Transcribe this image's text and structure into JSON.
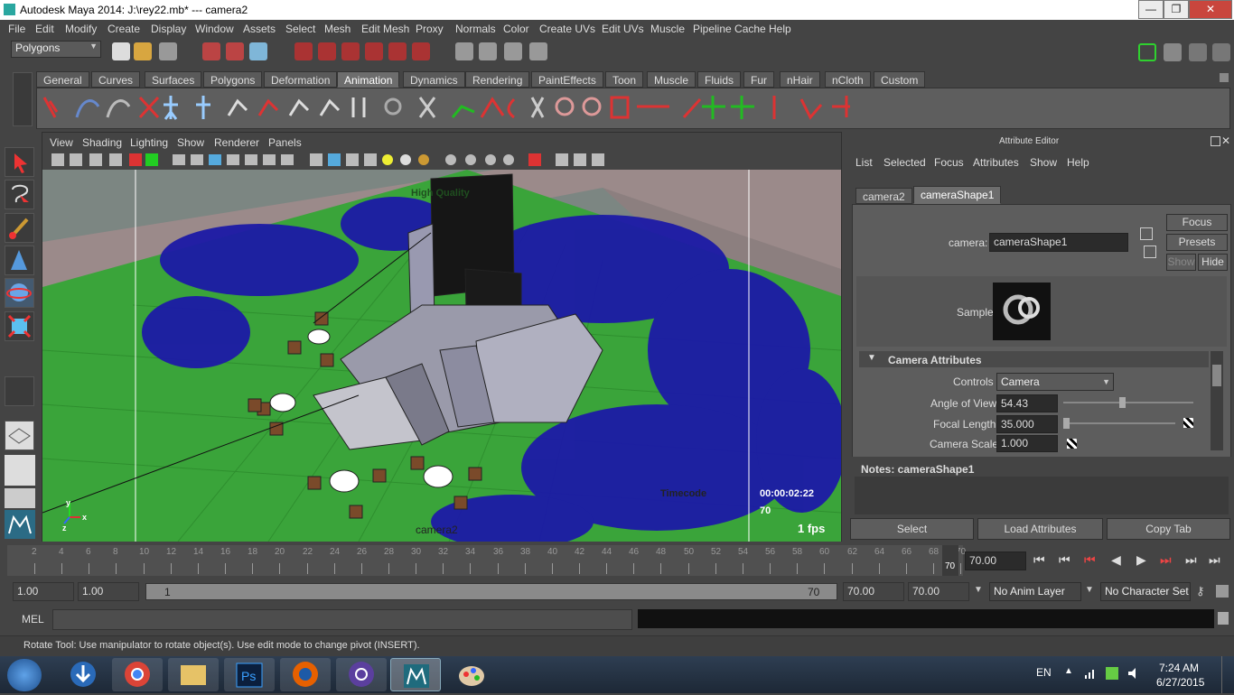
{
  "window": {
    "title": "Autodesk Maya 2014: J:\\rey22.mb*   ---   camera2",
    "min": "—",
    "max": "❐",
    "close": "✕"
  },
  "menubar": [
    "File",
    "Edit",
    "Modify",
    "Create",
    "Display",
    "Window",
    "Assets",
    "Select",
    "Mesh",
    "Edit Mesh",
    "Proxy",
    "Normals",
    "Color",
    "Create UVs",
    "Edit UVs",
    "Muscle",
    "Pipeline Cache",
    "Help"
  ],
  "statusline": {
    "menuset": "Polygons"
  },
  "shelf": {
    "tabs": [
      "General",
      "Curves",
      "Surfaces",
      "Polygons",
      "Deformation",
      "Animation",
      "Dynamics",
      "Rendering",
      "PaintEffects",
      "Toon",
      "Muscle",
      "Fluids",
      "Fur",
      "nHair",
      "nCloth",
      "Custom"
    ],
    "active_tab": "Animation"
  },
  "viewport": {
    "menus": [
      "View",
      "Shading",
      "Lighting",
      "Show",
      "Renderer",
      "Panels"
    ],
    "camera_name": "camera2",
    "hud_quality": "High Quality",
    "hud_timecode_label": "Timecode",
    "hud_timecode": "00:00:02:22",
    "hud_frame": "70",
    "hud_fps": "1 fps",
    "axis": {
      "x": "x",
      "y": "y",
      "z": "z"
    }
  },
  "attribute_editor": {
    "title": "Attribute Editor",
    "menus": [
      "List",
      "Selected",
      "Focus",
      "Attributes",
      "Show",
      "Help"
    ],
    "tabs": [
      "camera2",
      "cameraShape1"
    ],
    "active_tab": "cameraShape1",
    "node_type_label": "camera:",
    "node_name": "cameraShape1",
    "focus_btn": "Focus",
    "presets_btn": "Presets",
    "show_btn": "Show",
    "hide_btn": "Hide",
    "sample_label": "Sample",
    "section": "Camera Attributes",
    "controls_label": "Controls",
    "controls_value": "Camera",
    "angle_label": "Angle of View",
    "angle_value": "54.43",
    "angle_level": 0.45,
    "focal_label": "Focal Length",
    "focal_value": "35.000",
    "focal_level": 0.0,
    "scale_label": "Camera Scale",
    "scale_value": "1.000",
    "notes_label": "Notes:  cameraShape1",
    "select_btn": "Select",
    "load_btn": "Load Attributes",
    "copy_btn": "Copy Tab"
  },
  "timeslider": {
    "ticks": [
      "2",
      "4",
      "6",
      "8",
      "10",
      "12",
      "14",
      "16",
      "18",
      "20",
      "22",
      "24",
      "26",
      "28",
      "30",
      "32",
      "34",
      "36",
      "38",
      "40",
      "42",
      "44",
      "46",
      "48",
      "50",
      "52",
      "54",
      "56",
      "58",
      "60",
      "62",
      "64",
      "66",
      "68",
      "70"
    ],
    "current_frame": "70",
    "current_frame_field": "70.00"
  },
  "rangeslider": {
    "start_time": "1.00",
    "playback_start": "1.00",
    "range_start_label": "1",
    "range_end_label": "70",
    "playback_end": "70.00",
    "end_time": "70.00",
    "anim_layer": "No Anim Layer",
    "character_set": "No Character Set"
  },
  "cmdline": {
    "label": "MEL"
  },
  "helpline": {
    "text": "Rotate Tool: Use manipulator to rotate object(s). Use edit mode to change pivot (INSERT)."
  },
  "taskbar": {
    "lang": "EN",
    "time": "7:24 AM",
    "date": "6/27/2015",
    "apps": [
      "start",
      "download",
      "chrome",
      "explorer",
      "photoshop",
      "firefox",
      "bittorrent",
      "maya",
      "paint"
    ]
  }
}
